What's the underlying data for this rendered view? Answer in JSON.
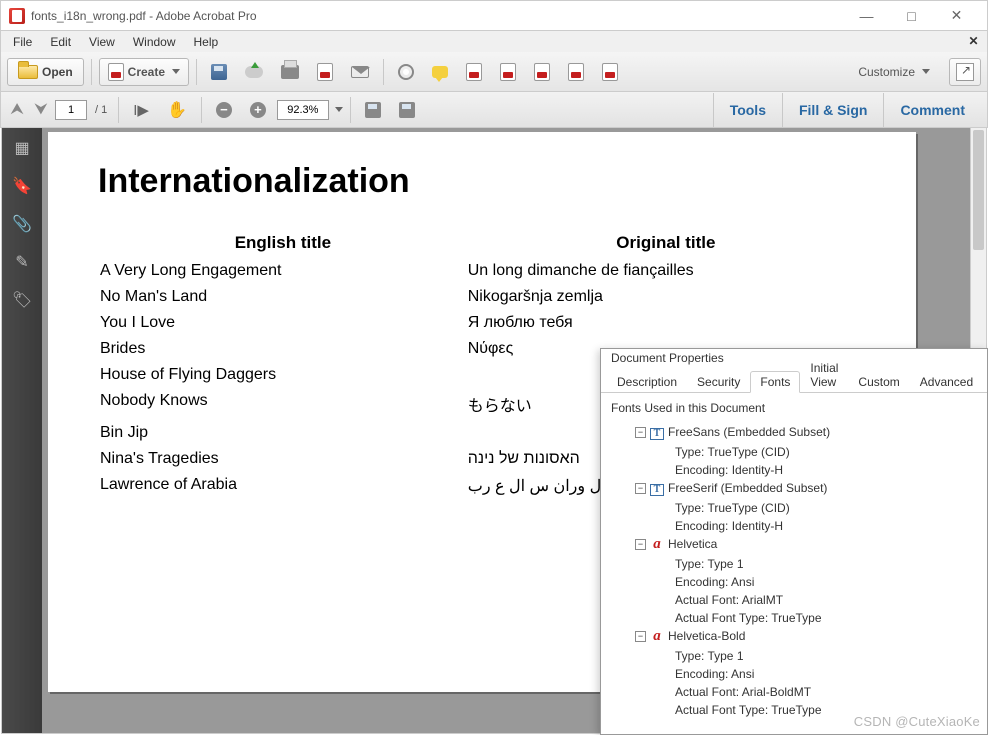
{
  "titlebar": {
    "title": "fonts_i18n_wrong.pdf - Adobe Acrobat Pro"
  },
  "menu": {
    "file": "File",
    "edit": "Edit",
    "view": "View",
    "window": "Window",
    "help": "Help"
  },
  "toolbar": {
    "open": "Open",
    "create": "Create",
    "customize": "Customize"
  },
  "nav": {
    "page_current": "1",
    "page_total": "/ 1",
    "zoom": "92.3%",
    "tools": "Tools",
    "fill": "Fill & Sign",
    "comment": "Comment"
  },
  "document": {
    "heading": "Internationalization",
    "col_english": "English title",
    "col_original": "Original title",
    "rows": [
      {
        "en": "A Very Long Engagement",
        "orig": "Un long dimanche de fiançailles"
      },
      {
        "en": "No Man's Land",
        "orig": "Nikogaršnja zemlja"
      },
      {
        "en": "You I Love",
        "orig": "Я люблю тебя"
      },
      {
        "en": "Brides",
        "orig": "Νύφες"
      },
      {
        "en": "House of Flying Daggers",
        "orig": ""
      },
      {
        "en": "Nobody Knows",
        "orig": "もらない"
      },
      {
        "en": "Bin Jip",
        "orig": ""
      },
      {
        "en": "Nina's Tragedies",
        "orig": "האסונות של נינה"
      },
      {
        "en": "Lawrence of Arabia",
        "orig": "ل وران س ال ع رب"
      }
    ]
  },
  "dialog": {
    "title": "Document Properties",
    "tabs": {
      "description": "Description",
      "security": "Security",
      "fonts": "Fonts",
      "initial": "Initial View",
      "custom": "Custom",
      "advanced": "Advanced"
    },
    "section": "Fonts Used in this Document",
    "fonts": [
      {
        "name": "FreeSans (Embedded Subset)",
        "icon": "tt",
        "details": [
          "Type: TrueType (CID)",
          "Encoding: Identity-H"
        ]
      },
      {
        "name": "FreeSerif (Embedded Subset)",
        "icon": "tt",
        "details": [
          "Type: TrueType (CID)",
          "Encoding: Identity-H"
        ]
      },
      {
        "name": "Helvetica",
        "icon": "t1",
        "details": [
          "Type: Type 1",
          "Encoding: Ansi",
          "Actual Font: ArialMT",
          "Actual Font Type: TrueType"
        ]
      },
      {
        "name": "Helvetica-Bold",
        "icon": "t1",
        "details": [
          "Type: Type 1",
          "Encoding: Ansi",
          "Actual Font: Arial-BoldMT",
          "Actual Font Type: TrueType"
        ]
      }
    ]
  },
  "watermark": "CSDN @CuteXiaoKe"
}
